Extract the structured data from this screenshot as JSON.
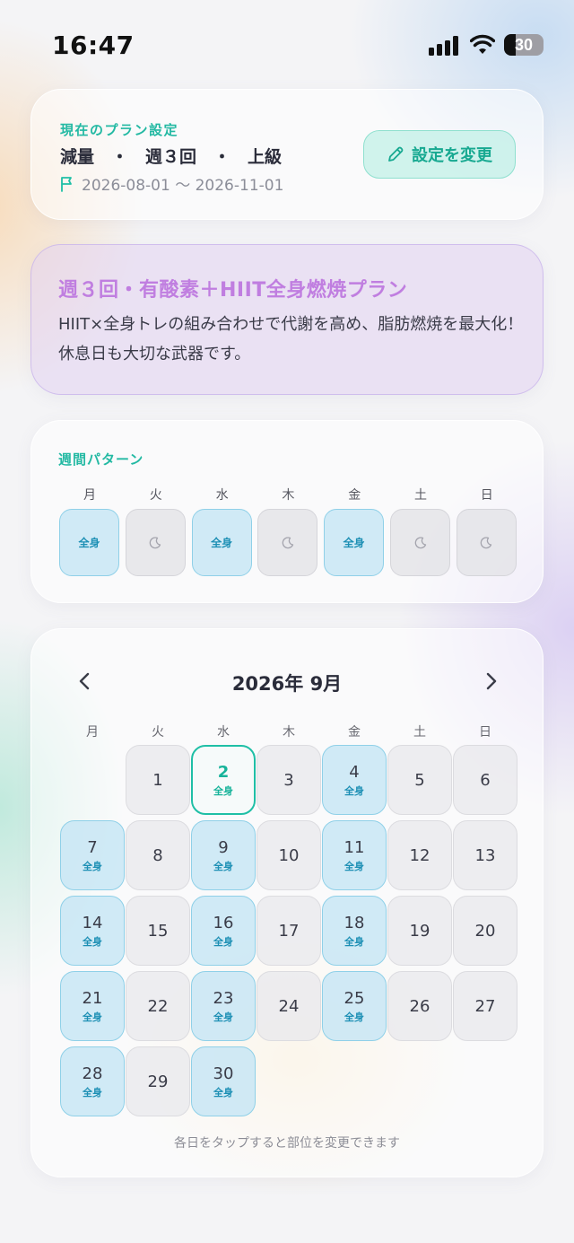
{
  "status_bar": {
    "time": "16:47",
    "battery": "30"
  },
  "plan": {
    "label": "現在のプラン設定",
    "summary": "減量　・　週３回　・　上級",
    "dates": "2026-08-01 〜 2026-11-01",
    "change_button": "設定を変更"
  },
  "description": {
    "title": "週３回・有酸素＋HIIT全身燃焼プラン",
    "text": "HIIT×全身トレの組み合わせで代謝を高め、脂肪燃焼を最大化！休息日も大切な武器です。"
  },
  "weekly_pattern": {
    "label": "週間パターン",
    "days": [
      {
        "name": "月",
        "type": "train",
        "label": "全身"
      },
      {
        "name": "火",
        "type": "rest",
        "label": ""
      },
      {
        "name": "水",
        "type": "train",
        "label": "全身"
      },
      {
        "name": "木",
        "type": "rest",
        "label": ""
      },
      {
        "name": "金",
        "type": "train",
        "label": "全身"
      },
      {
        "name": "土",
        "type": "rest",
        "label": ""
      },
      {
        "name": "日",
        "type": "rest",
        "label": ""
      }
    ]
  },
  "calendar": {
    "title": "2026年 9月",
    "weekdays": [
      "月",
      "火",
      "水",
      "木",
      "金",
      "土",
      "日"
    ],
    "start_offset": 1,
    "today": 2,
    "days": [
      {
        "day": "1",
        "label": ""
      },
      {
        "day": "2",
        "label": "全身"
      },
      {
        "day": "3",
        "label": ""
      },
      {
        "day": "4",
        "label": "全身"
      },
      {
        "day": "5",
        "label": ""
      },
      {
        "day": "6",
        "label": ""
      },
      {
        "day": "7",
        "label": "全身"
      },
      {
        "day": "8",
        "label": ""
      },
      {
        "day": "9",
        "label": "全身"
      },
      {
        "day": "10",
        "label": ""
      },
      {
        "day": "11",
        "label": "全身"
      },
      {
        "day": "12",
        "label": ""
      },
      {
        "day": "13",
        "label": ""
      },
      {
        "day": "14",
        "label": "全身"
      },
      {
        "day": "15",
        "label": ""
      },
      {
        "day": "16",
        "label": "全身"
      },
      {
        "day": "17",
        "label": ""
      },
      {
        "day": "18",
        "label": "全身"
      },
      {
        "day": "19",
        "label": ""
      },
      {
        "day": "20",
        "label": ""
      },
      {
        "day": "21",
        "label": "全身"
      },
      {
        "day": "22",
        "label": ""
      },
      {
        "day": "23",
        "label": "全身"
      },
      {
        "day": "24",
        "label": ""
      },
      {
        "day": "25",
        "label": "全身"
      },
      {
        "day": "26",
        "label": ""
      },
      {
        "day": "27",
        "label": ""
      },
      {
        "day": "28",
        "label": "全身"
      },
      {
        "day": "29",
        "label": ""
      },
      {
        "day": "30",
        "label": "全身"
      }
    ],
    "hint": "各日をタップすると部位を変更できます"
  }
}
